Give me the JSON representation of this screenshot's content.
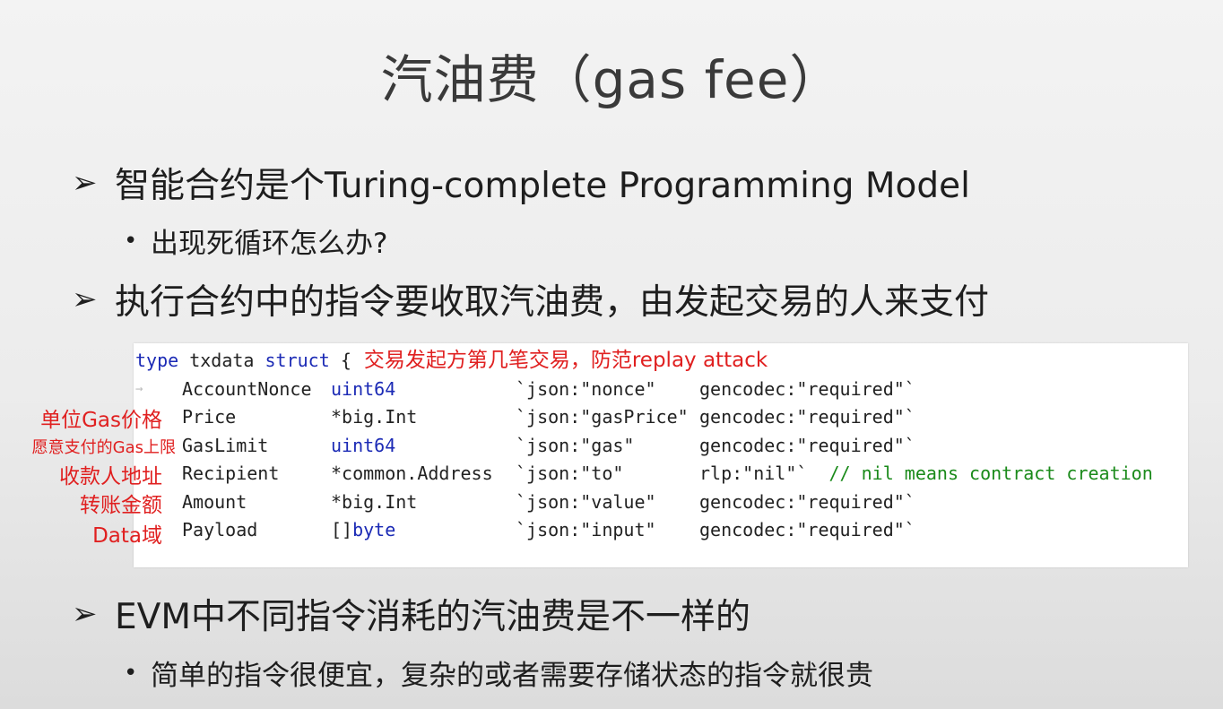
{
  "slide": {
    "title": "汽油费（gas fee）",
    "bullets": [
      {
        "arrow": "➢",
        "text": "智能合约是个Turing-complete Programming Model"
      },
      {
        "arrow": "➢",
        "text": "执行合约中的指令要收取汽油费，由发起交易的人来支付"
      },
      {
        "arrow": "➢",
        "text": "EVM中不同指令消耗的汽油费是不一样的"
      }
    ],
    "subbullets": [
      {
        "dot": "•",
        "text": "出现死循环怎么办?"
      },
      {
        "dot": "•",
        "text": "简单的指令很便宜，复杂的或者需要存储状态的指令就很贵"
      }
    ]
  },
  "code": {
    "header": {
      "kw1": "type",
      "name": "txdata",
      "kw2": "struct",
      "brace": "{"
    },
    "header_annotation": "交易发起方第几笔交易，防范replay attack",
    "gutter_mark": "→",
    "fields": [
      {
        "name": "AccountNonce",
        "type": "uint64",
        "type_is_keyword": true,
        "json": "`json:\"nonce\"",
        "extra": "gencodec:\"required\"`",
        "comment": ""
      },
      {
        "name": "Price",
        "type": "*big.Int",
        "type_is_keyword": false,
        "json": "`json:\"gasPrice\"",
        "extra": "gencodec:\"required\"`",
        "comment": ""
      },
      {
        "name": "GasLimit",
        "type": "uint64",
        "type_is_keyword": true,
        "json": "`json:\"gas\"",
        "extra": "gencodec:\"required\"`",
        "comment": ""
      },
      {
        "name": "Recipient",
        "type": "*common.Address",
        "type_is_keyword": false,
        "json": "`json:\"to\"",
        "extra": "rlp:\"nil\"`",
        "comment": "// nil means contract creation"
      },
      {
        "name": "Amount",
        "type": "*big.Int",
        "type_is_keyword": false,
        "json": "`json:\"value\"",
        "extra": "gencodec:\"required\"`",
        "comment": ""
      },
      {
        "name": "Payload",
        "type_prefix": "[]",
        "type": "byte",
        "type_is_keyword": true,
        "json": "`json:\"input\"",
        "extra": "gencodec:\"required\"`",
        "comment": ""
      }
    ]
  },
  "side_labels": [
    "单位Gas价格",
    "愿意支付的Gas上限",
    "收款人地址",
    "转账金额",
    "Data域"
  ],
  "colors": {
    "annotation": "#e02020",
    "keyword": "#1b2ab5",
    "comment": "#1a8a1a"
  }
}
